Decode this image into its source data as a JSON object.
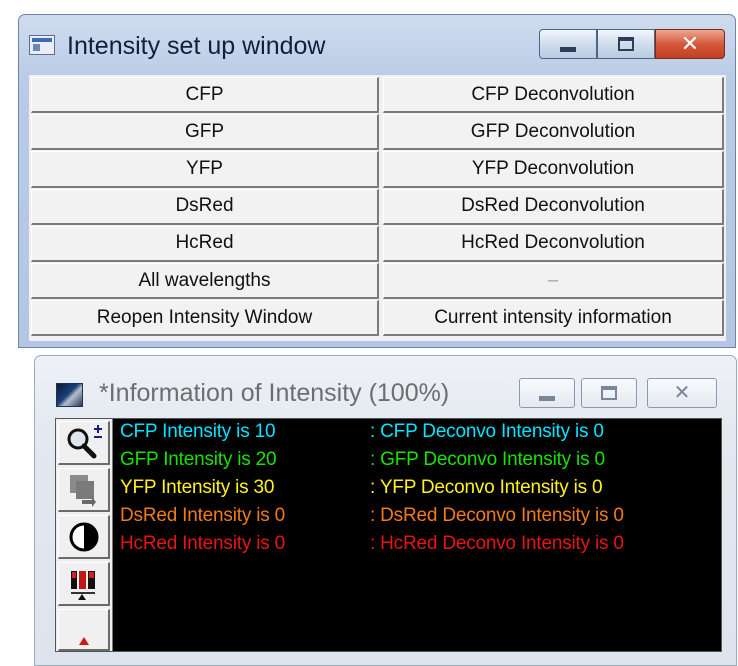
{
  "setup_window": {
    "title": "Intensity set up window",
    "buttons": [
      {
        "left": "CFP",
        "right": "CFP Deconvolution",
        "right_enabled": true
      },
      {
        "left": "GFP",
        "right": "GFP Deconvolution",
        "right_enabled": true
      },
      {
        "left": "YFP",
        "right": "YFP Deconvolution",
        "right_enabled": true
      },
      {
        "left": "DsRed",
        "right": "DsRed Deconvolution",
        "right_enabled": true
      },
      {
        "left": "HcRed",
        "right": "HcRed Deconvolution",
        "right_enabled": true
      },
      {
        "left": "All wavelengths",
        "right": "–",
        "right_enabled": false
      },
      {
        "left": "Reopen Intensity Window",
        "right": "Current intensity information",
        "right_enabled": true
      }
    ]
  },
  "info_window": {
    "title": "*Information of Intensity (100%)",
    "tools": [
      "zoom-icon",
      "layers-icon",
      "contrast-icon",
      "channels-icon",
      "marker-icon"
    ],
    "lines": [
      {
        "left": "CFP Intensity is 10",
        "right": ": CFP Deconvo Intensity is 0",
        "color": "#00e5ff"
      },
      {
        "left": "GFP Intensity is 20",
        "right": ": GFP Deconvo Intensity is 0",
        "color": "#17e300"
      },
      {
        "left": "YFP Intensity is 30",
        "right": ": YFP Deconvo Intensity is 0",
        "color": "#fff21a"
      },
      {
        "left": "DsRed Intensity is 0",
        "right": ": DsRed Deconvo Intensity is 0",
        "color": "#f27a1a"
      },
      {
        "left": "HcRed Intensity is 0",
        "right": ": HcRed Deconvo Intensity is 0",
        "color": "#e81414"
      }
    ]
  },
  "colors": {
    "aero_titlebar": "#b9cbe6",
    "close_button": "#d5593d",
    "info_background": "#000000"
  }
}
